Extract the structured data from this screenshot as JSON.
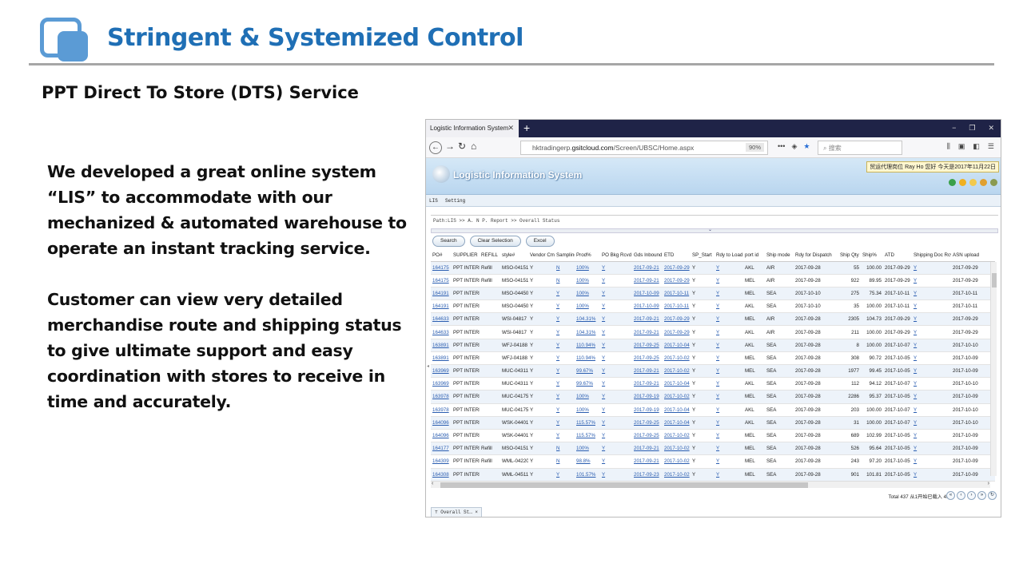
{
  "slide": {
    "title": "Stringent & Systemized Control",
    "subtitle": "PPT Direct To Store (DTS) Service",
    "para1": "We developed a great online system “LIS” to accommodate with our mechanized & automated warehouse to operate an instant tracking service.",
    "para2": "Customer can view very detailed merchandise route and shipping status to give ultimate support and easy coordination with stores to receive in time and accurately."
  },
  "browser": {
    "tab_title": "Logistic Information System",
    "url_host": "hktradingerp.",
    "url_domain": "gsitcloud.com",
    "url_path": "/Screen/UBSC/Home.aspx",
    "zoom": "90%",
    "search_placeholder": "搜索"
  },
  "app": {
    "title": "Logistic Information System",
    "user_info": "贸运代理岗位 Ray Ho 您好 今天是2017年11月22日",
    "menu": [
      "LIS",
      "Setting"
    ],
    "path": "Path:LIS >> A. N P. Report >> Overall Status",
    "buttons": {
      "search": "Search",
      "clear": "Clear Selection",
      "excel": "Excel"
    },
    "columns": [
      "PO#",
      "SUPPLIER",
      "REFILL",
      "style#",
      "Vendor Cmf",
      "Sampling",
      "Prod%",
      "PO Bkg Rcvd",
      "Gds Inbound",
      "ETD",
      "SP_Start",
      "Rdy to Load",
      "port id",
      "Ship mode",
      "Rdy for Dispatch",
      "Ship Qty",
      "Ship%",
      "ATD",
      "Shipping Doc Rcv",
      "ASN upload"
    ],
    "rows": [
      [
        "164175",
        "PPT INTERN",
        "Refill",
        "MSO-04151",
        "Y",
        "N",
        "100%",
        "Y",
        "2017-09-21",
        "2017-09-29",
        "Y",
        "Y",
        "AKL",
        "AIR",
        "2017-09-28",
        "55",
        "100.00",
        "2017-09-29",
        "Y",
        "2017-09-29"
      ],
      [
        "164175",
        "PPT INTERN",
        "Refill",
        "MSO-04151",
        "Y",
        "N",
        "100%",
        "Y",
        "2017-09-21",
        "2017-09-29",
        "Y",
        "Y",
        "MEL",
        "AIR",
        "2017-09-28",
        "922",
        "89.95",
        "2017-09-29",
        "Y",
        "2017-09-29"
      ],
      [
        "164191",
        "PPT INTERN",
        "",
        "MSO-04450",
        "Y",
        "Y",
        "100%",
        "Y",
        "2017-10-09",
        "2017-10-11",
        "Y",
        "Y",
        "MEL",
        "SEA",
        "2017-10-10",
        "275",
        "75.34",
        "2017-10-11",
        "Y",
        "2017-10-11"
      ],
      [
        "164191",
        "PPT INTERN",
        "",
        "MSO-04450",
        "Y",
        "Y",
        "100%",
        "Y",
        "2017-10-09",
        "2017-10-11",
        "Y",
        "Y",
        "AKL",
        "SEA",
        "2017-10-10",
        "35",
        "100.00",
        "2017-10-11",
        "Y",
        "2017-10-11"
      ],
      [
        "164633",
        "PPT INTERN",
        "",
        "WSI-04817",
        "Y",
        "Y",
        "104.31%",
        "Y",
        "2017-09-21",
        "2017-09-29",
        "Y",
        "Y",
        "MEL",
        "AIR",
        "2017-09-28",
        "2305",
        "104.73",
        "2017-09-29",
        "Y",
        "2017-09-29"
      ],
      [
        "164633",
        "PPT INTERN",
        "",
        "WSI-04817",
        "Y",
        "Y",
        "104.31%",
        "Y",
        "2017-09-21",
        "2017-09-29",
        "Y",
        "Y",
        "AKL",
        "AIR",
        "2017-09-28",
        "211",
        "100.00",
        "2017-09-29",
        "Y",
        "2017-09-29"
      ],
      [
        "163891",
        "PPT INTERN",
        "",
        "WFJ-04188",
        "Y",
        "Y",
        "110.94%",
        "Y",
        "2017-09-25",
        "2017-10-04",
        "Y",
        "Y",
        "AKL",
        "SEA",
        "2017-09-28",
        "8",
        "100.00",
        "2017-10-07",
        "Y",
        "2017-10-10"
      ],
      [
        "163891",
        "PPT INTERN",
        "",
        "WFJ-04188",
        "Y",
        "Y",
        "110.94%",
        "Y",
        "2017-09-25",
        "2017-10-02",
        "Y",
        "Y",
        "MEL",
        "SEA",
        "2017-09-28",
        "308",
        "90.72",
        "2017-10-05",
        "Y",
        "2017-10-09"
      ],
      [
        "163969",
        "PPT INTERN",
        "",
        "MUC-04311",
        "Y",
        "Y",
        "99.67%",
        "Y",
        "2017-09-21",
        "2017-10-02",
        "Y",
        "Y",
        "MEL",
        "SEA",
        "2017-09-28",
        "1977",
        "99.45",
        "2017-10-05",
        "Y",
        "2017-10-09"
      ],
      [
        "163969",
        "PPT INTERN",
        "",
        "MUC-04311",
        "Y",
        "Y",
        "99.67%",
        "Y",
        "2017-09-21",
        "2017-10-04",
        "Y",
        "Y",
        "AKL",
        "SEA",
        "2017-09-28",
        "112",
        "94.12",
        "2017-10-07",
        "Y",
        "2017-10-10"
      ],
      [
        "163978",
        "PPT INTERN",
        "",
        "MUC-04175",
        "Y",
        "Y",
        "100%",
        "Y",
        "2017-09-19",
        "2017-10-02",
        "Y",
        "Y",
        "MEL",
        "SEA",
        "2017-09-28",
        "2286",
        "95.37",
        "2017-10-05",
        "Y",
        "2017-10-09"
      ],
      [
        "163978",
        "PPT INTERN",
        "",
        "MUC-04175",
        "Y",
        "Y",
        "100%",
        "Y",
        "2017-09-19",
        "2017-10-04",
        "Y",
        "Y",
        "AKL",
        "SEA",
        "2017-09-28",
        "203",
        "100.00",
        "2017-10-07",
        "Y",
        "2017-10-10"
      ],
      [
        "164096",
        "PPT INTERN",
        "",
        "WSK-04401",
        "Y",
        "Y",
        "115.57%",
        "Y",
        "2017-09-25",
        "2017-10-04",
        "Y",
        "Y",
        "AKL",
        "SEA",
        "2017-09-28",
        "31",
        "100.00",
        "2017-10-07",
        "Y",
        "2017-10-10"
      ],
      [
        "164096",
        "PPT INTERN",
        "",
        "WSK-04401",
        "Y",
        "Y",
        "115.57%",
        "Y",
        "2017-09-25",
        "2017-10-02",
        "Y",
        "Y",
        "MEL",
        "SEA",
        "2017-09-28",
        "689",
        "102.99",
        "2017-10-05",
        "Y",
        "2017-10-09"
      ],
      [
        "164177",
        "PPT INTERN",
        "Refill",
        "MSO-04151",
        "Y",
        "N",
        "100%",
        "Y",
        "2017-09-21",
        "2017-10-02",
        "Y",
        "Y",
        "MEL",
        "SEA",
        "2017-09-28",
        "526",
        "95.64",
        "2017-10-05",
        "Y",
        "2017-10-09"
      ],
      [
        "164309",
        "PPT INTERN",
        "Refill",
        "WML-04220",
        "Y",
        "N",
        "98.8%",
        "Y",
        "2017-09-21",
        "2017-10-02",
        "Y",
        "Y",
        "MEL",
        "SEA",
        "2017-09-28",
        "243",
        "97.20",
        "2017-10-05",
        "Y",
        "2017-10-09"
      ],
      [
        "164308",
        "PPT INTERN",
        "",
        "WML-04511",
        "Y",
        "Y",
        "101.57%",
        "Y",
        "2017-09-23",
        "2017-10-02",
        "Y",
        "Y",
        "MEL",
        "SEA",
        "2017-09-28",
        "901",
        "101.81",
        "2017-10-05",
        "Y",
        "2017-10-09"
      ]
    ],
    "link_cols": [
      0,
      5,
      6,
      7,
      8,
      9,
      11,
      18
    ],
    "num_cols": [
      15,
      16
    ],
    "total_text": "Total 437 从1开始已载入 437",
    "bottom_tab": "Overall St…"
  }
}
